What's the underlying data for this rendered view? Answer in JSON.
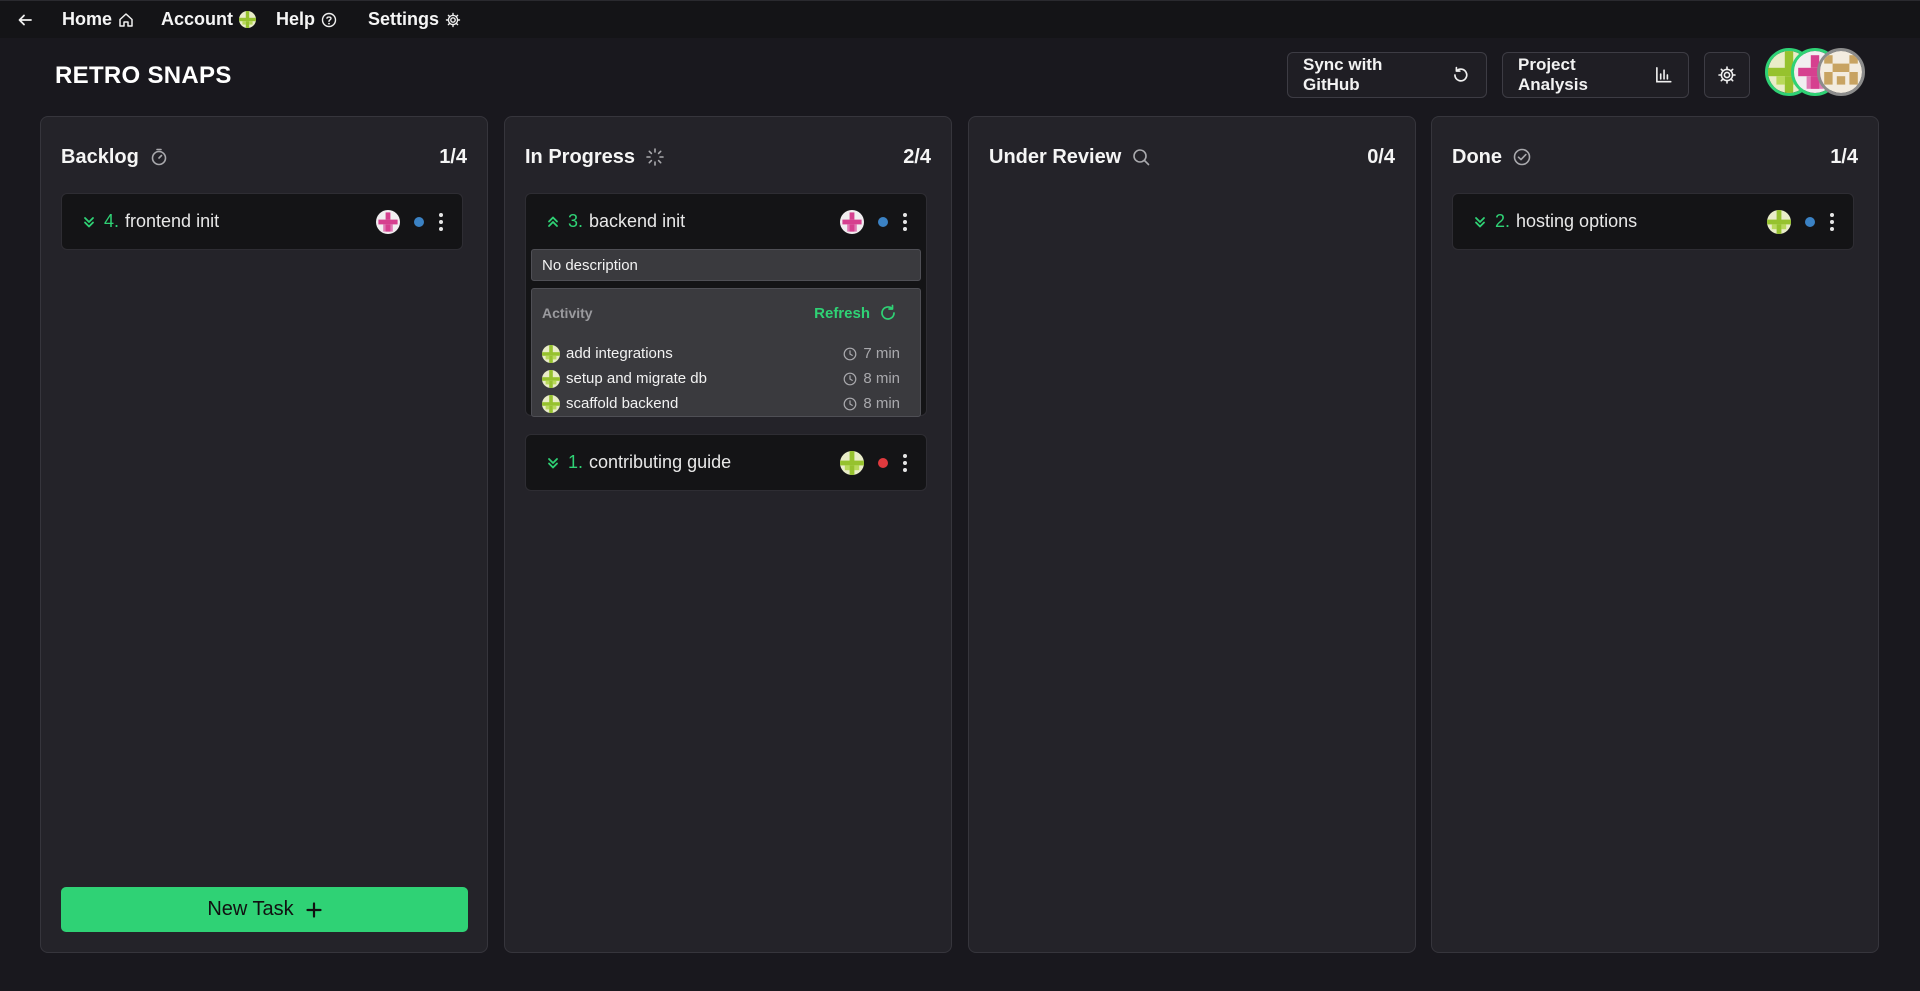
{
  "nav": {
    "home": "Home",
    "account": "Account",
    "help": "Help",
    "settings": "Settings"
  },
  "brand": "RETRO SNAPS",
  "header": {
    "sync_label": "Sync with GitHub",
    "analysis_label": "Project Analysis"
  },
  "colors": {
    "accent": "#2fd275",
    "status_blue": "#3b82c4",
    "status_red": "#e03a3e",
    "panel": "#242329",
    "card": "#141416"
  },
  "columns": [
    {
      "title": "Backlog",
      "icon": "timer-icon",
      "count": "1/4",
      "cards": [
        {
          "number": "4.",
          "title": "frontend init",
          "priority": "chevrons-down",
          "status": "blue",
          "assignee": "pink-avatar"
        }
      ],
      "new_task_label": "New Task"
    },
    {
      "title": "In Progress",
      "icon": "loader-icon",
      "count": "2/4",
      "cards": [
        {
          "number": "3.",
          "title": "backend init",
          "priority": "chevrons-up",
          "status": "blue",
          "assignee": "pink-avatar",
          "expanded": true,
          "description": "No description",
          "activity_title": "Activity",
          "refresh_label": "Refresh",
          "activity": [
            {
              "text": "add integrations",
              "time": "7 min"
            },
            {
              "text": "setup and migrate db",
              "time": "8 min"
            },
            {
              "text": "scaffold backend",
              "time": "8 min"
            }
          ]
        },
        {
          "number": "1.",
          "title": "contributing guide",
          "priority": "chevrons-down",
          "status": "red",
          "assignee": "green-avatar"
        }
      ]
    },
    {
      "title": "Under Review",
      "icon": "search-icon",
      "count": "0/4",
      "cards": []
    },
    {
      "title": "Done",
      "icon": "check-circle-icon",
      "count": "1/4",
      "cards": [
        {
          "number": "2.",
          "title": "hosting options",
          "priority": "chevrons-down",
          "status": "blue",
          "assignee": "green-avatar"
        }
      ]
    }
  ]
}
